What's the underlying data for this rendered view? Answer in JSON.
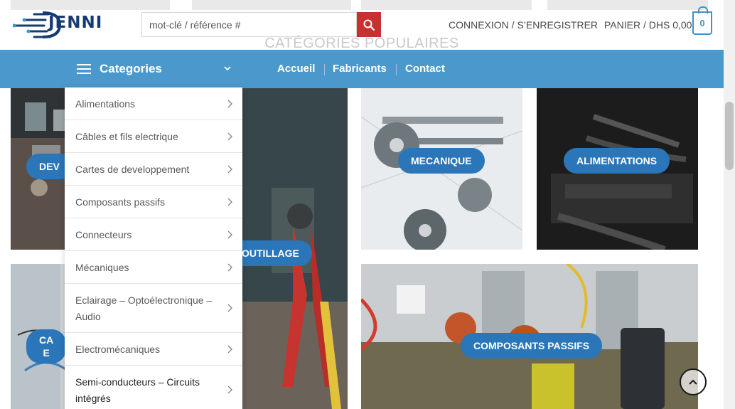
{
  "header": {
    "logo_text": "JENNI",
    "search": {
      "placeholder": "mot-clé / référence #"
    },
    "login_label": "CONNEXION / S’ENREGISTRER",
    "cart_label": "PANIER / DHS 0,00",
    "cart_count": "0"
  },
  "section_title": "CATÉGORIES POPULAIRES",
  "nav": {
    "categories_label": "Categories",
    "links": [
      "Accueil",
      "Fabricants",
      "Contact"
    ]
  },
  "dropdown": {
    "items": [
      "Alimentations",
      "Câbles et fils electrique",
      "Cartes de developpement",
      "Composants passifs",
      "Connecteurs",
      "Mécaniques",
      "Eclairage – Optoélectronique – Audio",
      "Electromécaniques",
      "Semi-conducteurs – Circuits intégrés"
    ]
  },
  "tiles": {
    "dev_label": "DEV",
    "outillage_label": "OUTILLAGE",
    "mecanique_label": "MECANIQUE",
    "alimentations_label": "ALIMENTATIONS",
    "cables_label_1": "CA",
    "cables_label_2": "E",
    "composants_label": "COMPOSANTS PASSIFS"
  },
  "colors": {
    "nav_bg": "#4b98cc",
    "accent_blue": "#2a76b8",
    "search_button": "#c8312f",
    "logo_blue": "#163b72"
  }
}
